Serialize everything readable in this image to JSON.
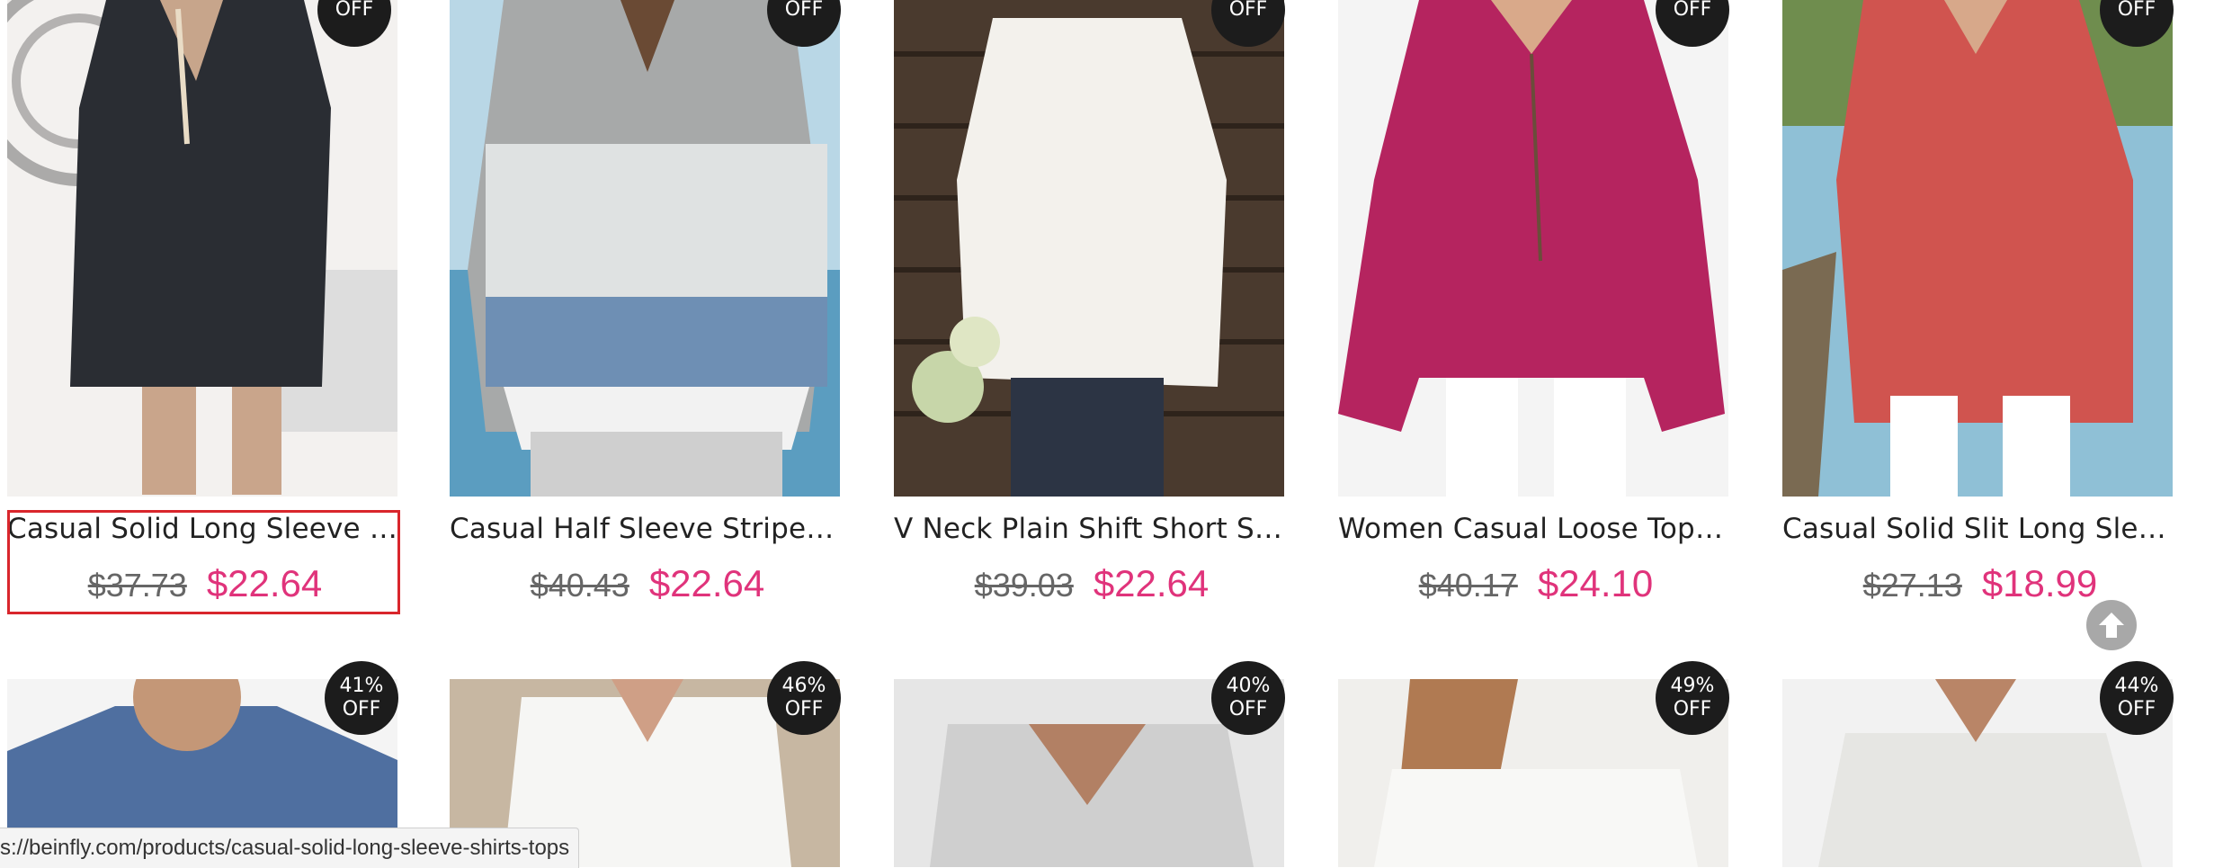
{
  "products": [
    {
      "title": "Casual Solid Long Sleeve Shirts...",
      "old_price": "$37.73",
      "new_price": "$22.64",
      "badge_top": "",
      "badge_bottom": "OFF"
    },
    {
      "title": "Casual Half Sleeve Striped Shir...",
      "old_price": "$40.43",
      "new_price": "$22.64",
      "badge_top": "",
      "badge_bottom": "OFF"
    },
    {
      "title": "V Neck Plain Shift Short Sleeve ...",
      "old_price": "$39.03",
      "new_price": "$22.64",
      "badge_top": "",
      "badge_bottom": "OFF"
    },
    {
      "title": "Women Casual Loose Tops Tuni...",
      "old_price": "$40.17",
      "new_price": "$24.10",
      "badge_top": "",
      "badge_bottom": "OFF"
    },
    {
      "title": "Casual Solid Slit Long Sleeve Pl...",
      "old_price": "$27.13",
      "new_price": "$18.99",
      "badge_top": "",
      "badge_bottom": "OFF"
    }
  ],
  "products_row2": [
    {
      "badge_top": "41%",
      "badge_bottom": "OFF"
    },
    {
      "badge_top": "46%",
      "badge_bottom": "OFF"
    },
    {
      "badge_top": "40%",
      "badge_bottom": "OFF"
    },
    {
      "badge_top": "49%",
      "badge_bottom": "OFF"
    },
    {
      "badge_top": "44%",
      "badge_bottom": "OFF"
    }
  ],
  "status_url": "s://beinfly.com/products/casual-solid-long-sleeve-shirts-tops",
  "icons": {
    "scroll_top": "arrow-up-circle-icon"
  },
  "colors": {
    "sale": "#e0337b",
    "badge": "#1c1c1c",
    "selection": "#d9262c"
  }
}
